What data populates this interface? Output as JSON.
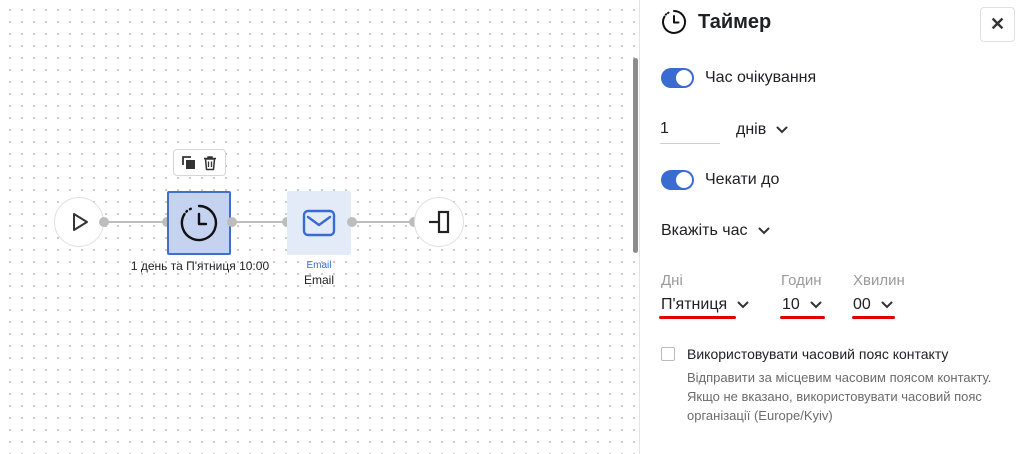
{
  "flow": {
    "timer_node_caption": "1 день та П'ятниця 10:00",
    "email_node_subcaption": "Email",
    "email_node_caption": "Email"
  },
  "panel": {
    "title": "Таймер",
    "close_label": "✕",
    "wait_time": {
      "label": "Час очікування",
      "enabled": true
    },
    "days_value": "1",
    "days_unit": "днів",
    "wait_until": {
      "label": "Чекати до",
      "enabled": true
    },
    "time_mode": "Вкажіть час",
    "day_field": {
      "label": "Дні",
      "value": "П'ятниця"
    },
    "hours_field": {
      "label": "Годин",
      "value": "10"
    },
    "minutes_field": {
      "label": "Хвилин",
      "value": "00"
    },
    "timezone": {
      "label": "Використовувати часовий пояс контакту",
      "checked": false,
      "help": "Відправити за місцевим часовим поясом контакту. Якщо не вказано, використовувати часовий пояс організації (Europe/Kyiv)"
    }
  },
  "colors": {
    "accent": "#3a6bd0",
    "highlight_underline": "#e00000",
    "node_selected_fill": "#c5d3f0",
    "email_node_fill": "#e3eaf8"
  },
  "icons": [
    "play-icon",
    "clock-icon",
    "mail-icon",
    "exit-icon",
    "copy-icon",
    "trash-icon",
    "timer-icon",
    "close-icon",
    "chevron-down-icon"
  ]
}
